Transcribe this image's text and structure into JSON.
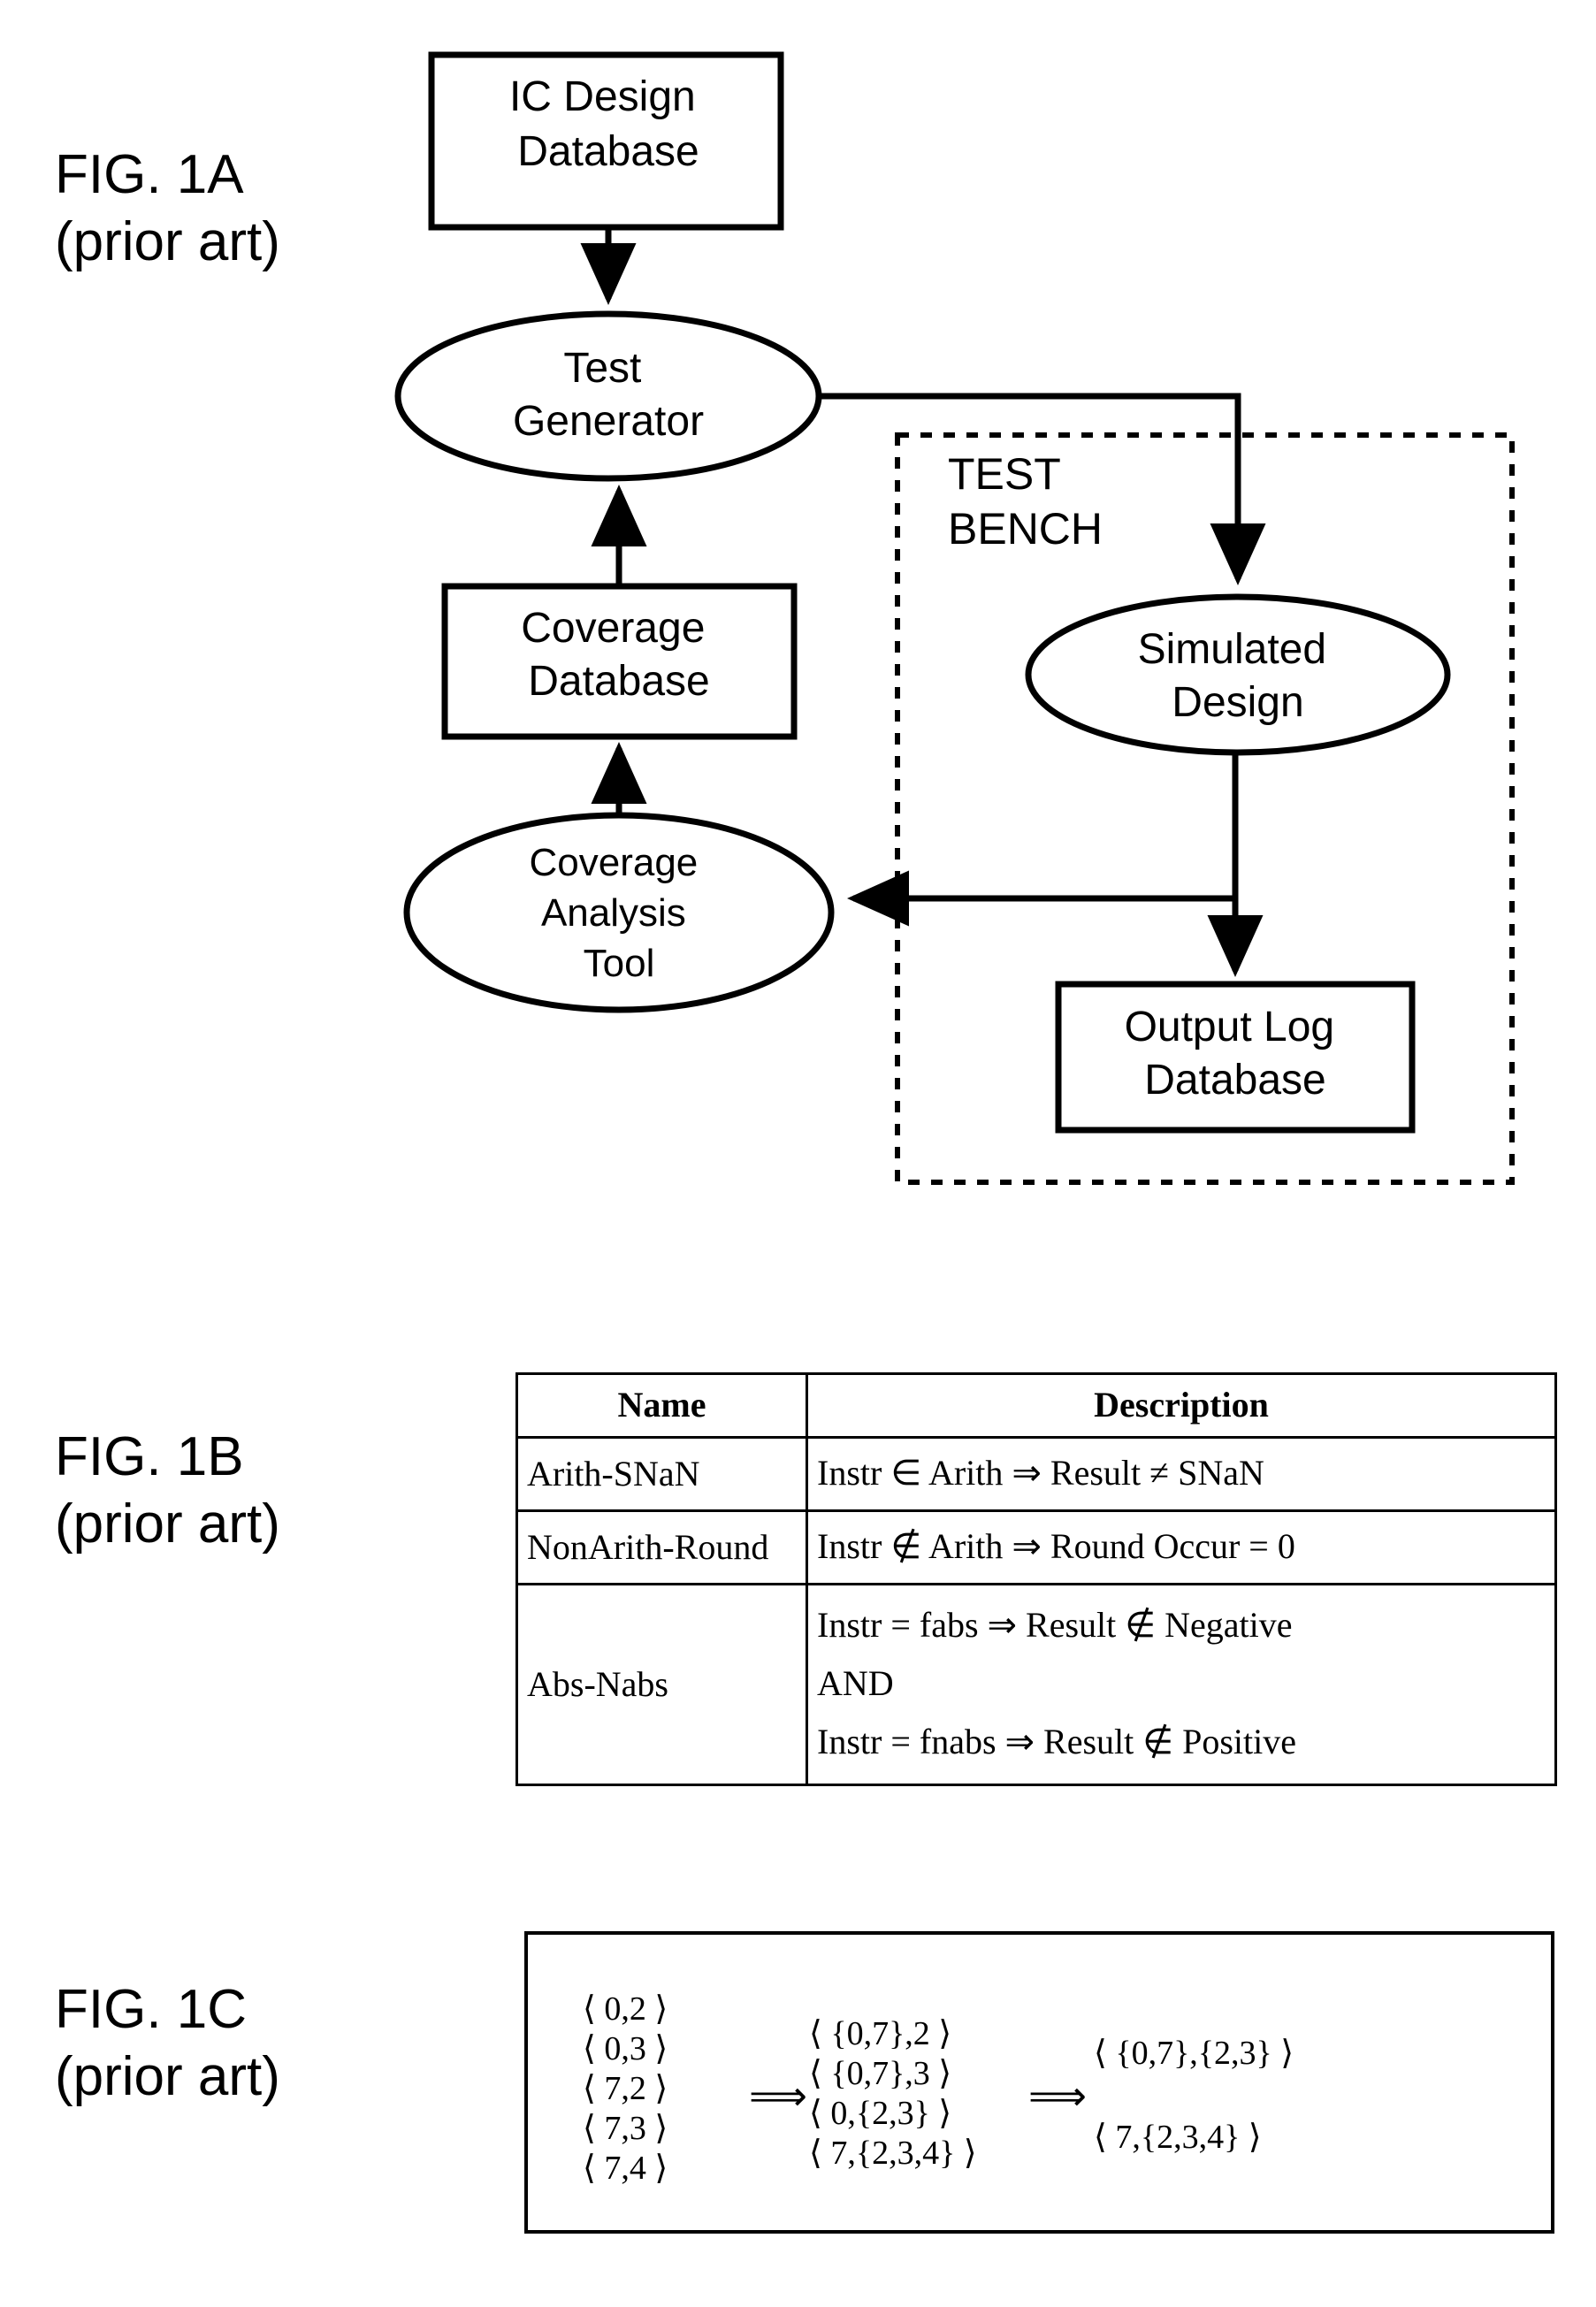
{
  "figures": {
    "fig1a": {
      "label_line1": "FIG. 1A",
      "label_line2": "(prior art)",
      "nodes": {
        "ic_design_database": "IC Design\nDatabase",
        "ic_design_database_l1": "IC Design",
        "ic_design_database_l2": "Database",
        "test_generator_l1": "Test",
        "test_generator_l2": "Generator",
        "coverage_database_l1": "Coverage",
        "coverage_database_l2": "Database",
        "coverage_analysis_tool_l1": "Coverage",
        "coverage_analysis_tool_l2": "Analysis",
        "coverage_analysis_tool_l3": "Tool",
        "test_bench_l1": "TEST",
        "test_bench_l2": "BENCH",
        "simulated_design_l1": "Simulated",
        "simulated_design_l2": "Design",
        "output_log_database_l1": "Output Log",
        "output_log_database_l2": "Database"
      },
      "colors": {
        "stroke": "#000000",
        "fill": "#ffffff"
      }
    },
    "fig1b": {
      "label_line1": "FIG. 1B",
      "label_line2": "(prior art)",
      "table": {
        "headers": [
          "Name",
          "Description"
        ],
        "rows": [
          {
            "name": "Arith-SNaN",
            "description_lines": [
              "Instr ∈ Arith ⇒ Result ≠ SNaN"
            ]
          },
          {
            "name": "NonArith-Round",
            "description_lines": [
              "Instr ∉ Arith ⇒ Round Occur = 0"
            ]
          },
          {
            "name": "Abs-Nabs",
            "description_lines": [
              "Instr = fabs ⇒ Result ∉ Negative",
              "AND",
              "Instr = fnabs ⇒ Result ∉ Positive"
            ]
          }
        ]
      }
    },
    "fig1c": {
      "label_line1": "FIG. 1C",
      "label_line2": "(prior art)",
      "arrow_symbol": "⟹",
      "columns": [
        {
          "id": "stage-1",
          "tuples": [
            "⟨ 0,2 ⟩",
            "⟨ 0,3 ⟩",
            "⟨ 7,2 ⟩",
            "⟨ 7,3 ⟩",
            "⟨ 7,4 ⟩"
          ]
        },
        {
          "id": "stage-2",
          "tuples": [
            "⟨ {0,7},2 ⟩",
            "⟨ {0,7},3 ⟩",
            "⟨ 0,{2,3} ⟩",
            "⟨ 7,{2,3,4} ⟩"
          ]
        },
        {
          "id": "stage-3",
          "tuples": [
            "⟨ {0,7},{2,3} ⟩",
            "⟨ 7,{2,3,4} ⟩"
          ]
        }
      ]
    }
  }
}
